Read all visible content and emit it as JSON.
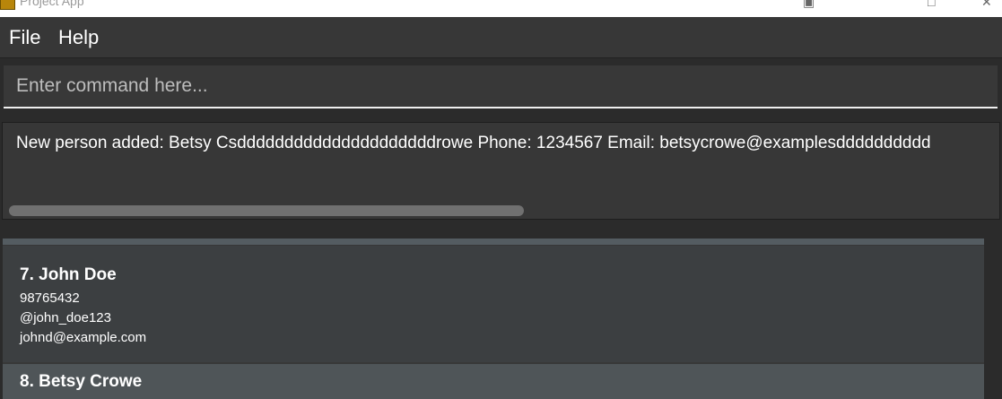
{
  "window": {
    "title": "Project App"
  },
  "menu": {
    "file": "File",
    "help": "Help"
  },
  "command": {
    "placeholder": "Enter command here...",
    "value": ""
  },
  "result": {
    "text": "New person added: Betsy Csdddddddddddddddddddddrowe Phone: 1234567 Email: betsycrowe@examplesdddddddddd"
  },
  "persons": [
    {
      "index": "7.",
      "name": "John Doe",
      "phone": "98765432",
      "handle": "@john_doe123",
      "email": "johnd@example.com"
    },
    {
      "index": "8.",
      "name": "Betsy Crowe"
    }
  ],
  "colors": {
    "background": "#2b2b2b",
    "panel": "#373737",
    "card": "#3c3f41",
    "selected_card": "#4f5558"
  }
}
